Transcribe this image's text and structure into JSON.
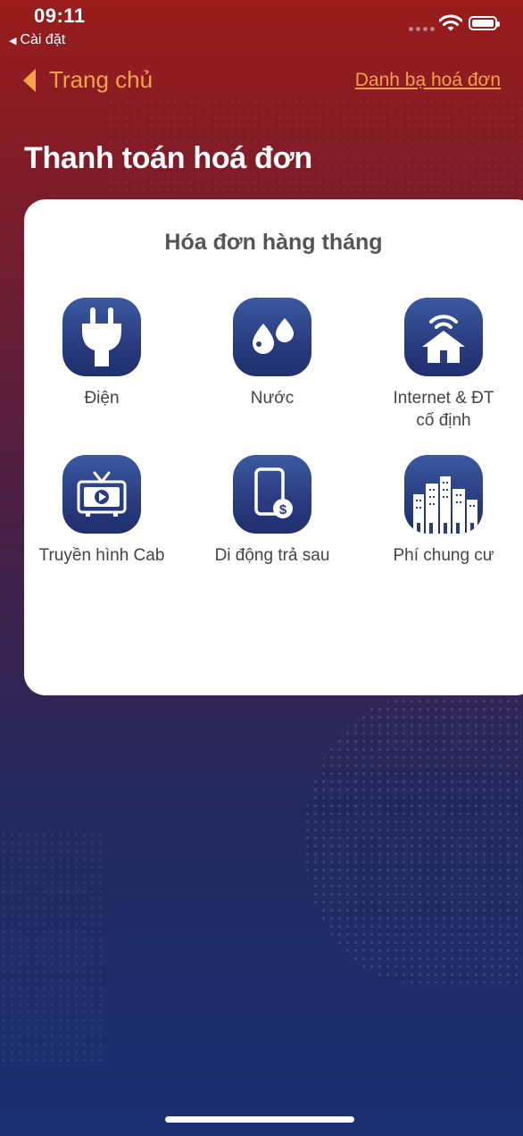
{
  "status_bar": {
    "time": "09:11",
    "back_app": "Cài đặt"
  },
  "nav": {
    "back_label": "Trang chủ",
    "right_link": "Danh bạ hoá đơn"
  },
  "page_title": "Thanh toán hoá đơn",
  "card": {
    "title": "Hóa đơn hàng tháng",
    "tiles": [
      {
        "label": "Điện",
        "icon": "plug-icon"
      },
      {
        "label": "Nước",
        "icon": "water-drops-icon"
      },
      {
        "label_line1": "Internet & ĐT",
        "label_line2": "cố định",
        "icon": "home-wifi-icon"
      },
      {
        "label": "Truyền hình Cab",
        "icon": "tv-icon"
      },
      {
        "label": "Di động trả sau",
        "icon": "mobile-payment-icon"
      },
      {
        "label": "Phí chung cư",
        "icon": "apartment-buildings-icon"
      }
    ]
  },
  "colors": {
    "accent": "#f3a14a",
    "icon_bg": "#2a3d82",
    "card_bg": "#ffffff"
  }
}
